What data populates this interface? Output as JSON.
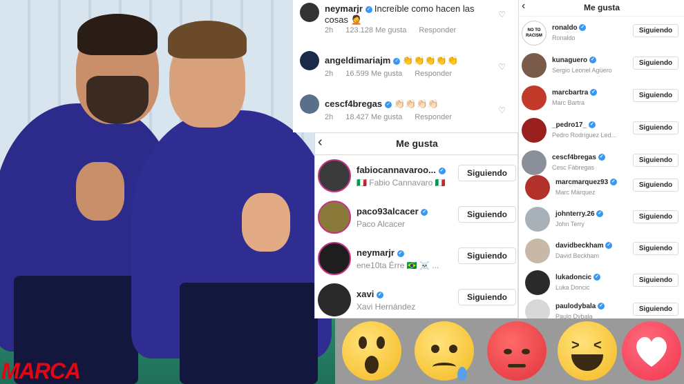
{
  "photo": {
    "watermark": "MARCA"
  },
  "comments": [
    {
      "user": "neymarjr",
      "text": "Increíble como hacen las cosas 🤦",
      "time": "2h",
      "likes": "123.128 Me gusta",
      "reply": "Responder"
    },
    {
      "user": "angeldimariajm",
      "text": "👏👏👏👏👏",
      "time": "2h",
      "likes": "16.599 Me gusta",
      "reply": "Responder"
    },
    {
      "user": "cescf4bregas",
      "text": "👏🏻👏🏻👏🏻👏🏻",
      "time": "2h",
      "likes": "18.427 Me gusta",
      "reply": "Responder"
    }
  ],
  "likes_mid": {
    "title": "Me gusta",
    "items": [
      {
        "user": "fabiocannavaroo...",
        "name": "🇮🇹 Fabio Cannavaro 🇮🇹",
        "button": "Siguiendo"
      },
      {
        "user": "paco93alcacer",
        "name": "Paco Alcacer",
        "button": "Siguiendo"
      },
      {
        "user": "neymarjr",
        "name": "ene10ta Érre 🇧🇷 ☠️ ...",
        "button": "Siguiendo"
      },
      {
        "user": "xavi",
        "name": "Xavi Hernández",
        "button": "Siguiendo"
      }
    ]
  },
  "likes_right": {
    "title": "Me gusta",
    "items": [
      {
        "user": "ronaldo",
        "name": "Ronaldo",
        "button": "Siguiendo",
        "logo": "NO TO RACISM"
      },
      {
        "user": "kunaguero",
        "name": "Sergio Leonel Agüero",
        "button": "Siguiendo"
      },
      {
        "user": "marcbartra",
        "name": "Marc Bartra",
        "button": "Siguiendo"
      },
      {
        "user": "_pedro17_",
        "name": "Pedro Rodríguez Led...",
        "button": "Siguiendo"
      },
      {
        "user": "cescf4bregas",
        "name": "Cesc Fàbregas",
        "button": "Siguiendo"
      },
      {
        "user": "marcmarquez93",
        "name": "Marc Márquez",
        "button": "Siguiendo"
      },
      {
        "user": "johnterry.26",
        "name": "John Terry",
        "button": "Siguiendo"
      },
      {
        "user": "davidbeckham",
        "name": "David Beckham",
        "button": "Siguiendo"
      },
      {
        "user": "lukadoncic",
        "name": "Luka Doncic",
        "button": "Siguiendo"
      },
      {
        "user": "paulodybala",
        "name": "Paulo Dybala",
        "button": "Siguiendo"
      }
    ]
  },
  "reactions": [
    "wow-icon",
    "sad-icon",
    "angry-icon",
    "haha-icon",
    "love-icon"
  ],
  "colors": {
    "verified": "#3897f0",
    "marca": "#e30613",
    "text": "#262626",
    "muted": "#8e8e8e"
  }
}
